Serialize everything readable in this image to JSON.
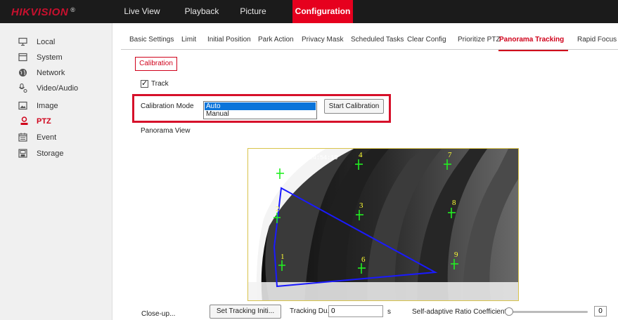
{
  "brand": {
    "logo": "HIKVISION",
    "reg_mark": "®",
    "color": "#c8102e"
  },
  "topnav": {
    "live_view": "Live View",
    "playback": "Playback",
    "picture": "Picture",
    "configuration": "Configuration",
    "active": "Configuration"
  },
  "sidebar": {
    "items": [
      {
        "label": "Local",
        "icon": "monitor-icon"
      },
      {
        "label": "System",
        "icon": "window-icon"
      },
      {
        "label": "Network",
        "icon": "globe-icon"
      },
      {
        "label": "Video/Audio",
        "icon": "video-audio-icon"
      },
      {
        "label": "Image",
        "icon": "image-icon"
      },
      {
        "label": "PTZ",
        "icon": "ptz-icon"
      },
      {
        "label": "Event",
        "icon": "calendar-icon"
      },
      {
        "label": "Storage",
        "icon": "storage-icon"
      }
    ],
    "active": "PTZ"
  },
  "subtabs": {
    "items": [
      "Basic Settings",
      "Limit",
      "Initial Position",
      "Park Action",
      "Privacy Mask",
      "Scheduled Tasks",
      "Clear Config",
      "Prioritize PTZ",
      "Panorama Tracking",
      "Rapid Focus"
    ],
    "active": "Panorama Tracking"
  },
  "calibration": {
    "tab_label": "Calibration",
    "track_label": "Track",
    "track_checked": true,
    "mode_label": "Calibration Mode",
    "mode_options": [
      "Auto",
      "Manual"
    ],
    "mode_selected": "Auto",
    "start_button": "Start Calibration"
  },
  "panorama": {
    "label": "Panorama View",
    "timestamp": "08-18-2020 Tue 14:54:19",
    "point_labels": [
      "1",
      "2",
      "3",
      "4",
      "6",
      "7",
      "8",
      "9"
    ],
    "marker_color": "#22ee22",
    "label_color": "#ffff33",
    "polygon_color": "#1a1aff"
  },
  "tracking": {
    "closeup_label": "Close-up...",
    "set_button": "Set Tracking Initi...",
    "duration_label": "Tracking Du...",
    "duration_value": "0",
    "duration_unit": "s",
    "ratio_label": "Self-adaptive Ratio Coefficient",
    "ratio_value": "0"
  },
  "colors": {
    "accent": "#e6001e",
    "selection": "#0a74da",
    "highlight_border": "#d6102a"
  }
}
